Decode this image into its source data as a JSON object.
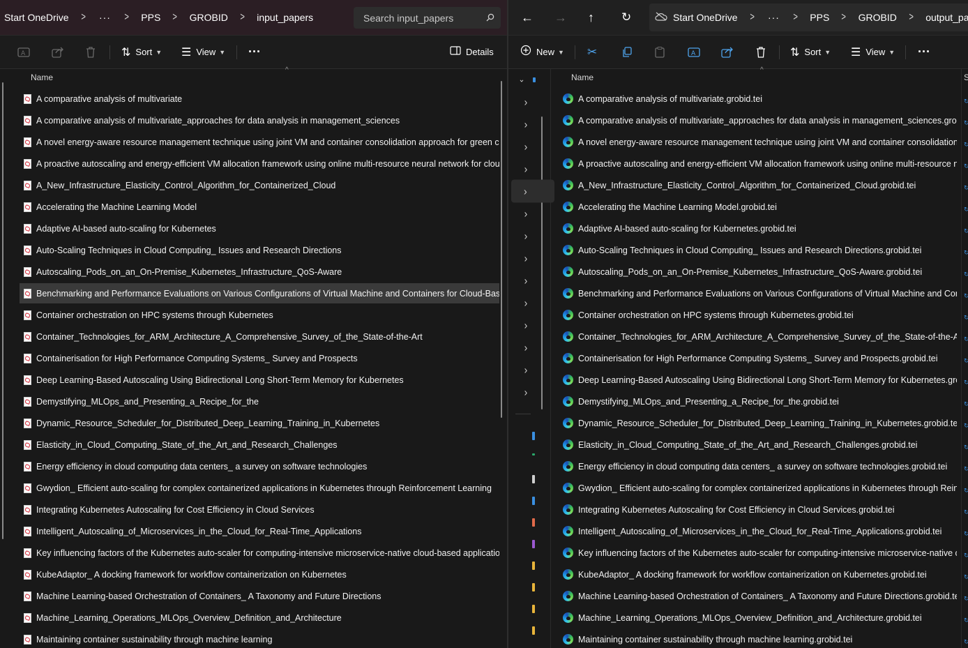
{
  "left": {
    "breadcrumbs": [
      "Start OneDrive",
      "PPS",
      "GROBID",
      "input_papers"
    ],
    "more": "···",
    "search_placeholder": "Search input_papers",
    "toolbar": {
      "sort": "Sort",
      "view": "View",
      "more": "···",
      "details": "Details"
    },
    "column_name": "Name",
    "selected_index": 9,
    "files": [
      "A comparative analysis of multivariate",
      "A comparative analysis of multivariate_approaches for data analysis in management_sciences",
      "A novel energy-aware resource management technique using joint VM and container consolidation approach for green comp",
      "A proactive autoscaling and energy-efficient VM allocation framework using online multi-resource neural network for cloud d",
      "A_New_Infrastructure_Elasticity_Control_Algorithm_for_Containerized_Cloud",
      "Accelerating the Machine Learning Model",
      "Adaptive AI-based auto-scaling for Kubernetes",
      "Auto-Scaling Techniques in Cloud Computing_ Issues and Research Directions",
      "Autoscaling_Pods_on_an_On-Premise_Kubernetes_Infrastructure_QoS-Aware",
      "Benchmarking and Performance Evaluations on Various Configurations of Virtual Machine and Containers for Cloud-Based Sc",
      "Container orchestration on HPC systems through Kubernetes",
      "Container_Technologies_for_ARM_Architecture_A_Comprehensive_Survey_of_the_State-of-the-Art",
      "Containerisation for High Performance Computing Systems_ Survey and Prospects",
      "Deep Learning-Based Autoscaling Using Bidirectional Long Short-Term Memory for Kubernetes",
      "Demystifying_MLOps_and_Presenting_a_Recipe_for_the",
      "Dynamic_Resource_Scheduler_for_Distributed_Deep_Learning_Training_in_Kubernetes",
      "Elasticity_in_Cloud_Computing_State_of_the_Art_and_Research_Challenges",
      "Energy efficiency in cloud computing data centers_ a survey on software technologies",
      "Gwydion_ Efficient auto-scaling for complex containerized applications in Kubernetes through Reinforcement Learning",
      "Integrating Kubernetes Autoscaling for Cost Efficiency in Cloud Services",
      "Intelligent_Autoscaling_of_Microservices_in_the_Cloud_for_Real-Time_Applications",
      "Key influencing factors of the Kubernetes auto-scaler for computing-intensive microservice-native cloud-based applications",
      "KubeAdaptor_ A docking framework for workflow containerization on Kubernetes",
      "Machine Learning-based Orchestration of Containers_ A Taxonomy and Future Directions",
      "Machine_Learning_Operations_MLOps_Overview_Definition_and_Architecture",
      "Maintaining container sustainability through machine learning"
    ]
  },
  "right": {
    "breadcrumbs": [
      "Start OneDrive",
      "PPS",
      "GROBID",
      "output_papers"
    ],
    "more": "···",
    "toolbar": {
      "new": "New",
      "sort": "Sort",
      "view": "View",
      "more": "···"
    },
    "column_name": "Name",
    "column_next": "S",
    "files": [
      "A comparative analysis of multivariate.grobid.tei",
      "A comparative analysis of multivariate_approaches for data analysis in management_sciences.grobid....",
      "A novel energy-aware resource management technique using joint VM and container consolidation a...",
      "A proactive autoscaling and energy-efficient VM allocation framework using online multi-resource n...",
      "A_New_Infrastructure_Elasticity_Control_Algorithm_for_Containerized_Cloud.grobid.tei",
      "Accelerating the Machine Learning Model.grobid.tei",
      "Adaptive AI-based auto-scaling for Kubernetes.grobid.tei",
      "Auto-Scaling Techniques in Cloud Computing_ Issues and Research Directions.grobid.tei",
      "Autoscaling_Pods_on_an_On-Premise_Kubernetes_Infrastructure_QoS-Aware.grobid.tei",
      "Benchmarking and Performance Evaluations on Various Configurations of Virtual Machine and Conta...",
      "Container orchestration on HPC systems through Kubernetes.grobid.tei",
      "Container_Technologies_for_ARM_Architecture_A_Comprehensive_Survey_of_the_State-of-the-Art.gr...",
      "Containerisation for High Performance Computing Systems_ Survey and Prospects.grobid.tei",
      "Deep Learning-Based Autoscaling Using Bidirectional Long Short-Term Memory for Kubernetes.grobi...",
      "Demystifying_MLOps_and_Presenting_a_Recipe_for_the.grobid.tei",
      "Dynamic_Resource_Scheduler_for_Distributed_Deep_Learning_Training_in_Kubernetes.grobid.tei",
      "Elasticity_in_Cloud_Computing_State_of_the_Art_and_Research_Challenges.grobid.tei",
      "Energy efficiency in cloud computing data centers_ a survey on software technologies.grobid.tei",
      "Gwydion_ Efficient auto-scaling for complex containerized applications in Kubernetes through Reinfo...",
      "Integrating Kubernetes Autoscaling for Cost Efficiency in Cloud Services.grobid.tei",
      "Intelligent_Autoscaling_of_Microservices_in_the_Cloud_for_Real-Time_Applications.grobid.tei",
      "Key influencing factors of the Kubernetes auto-scaler for computing-intensive microservice-native cl...",
      "KubeAdaptor_ A docking framework for workflow containerization on Kubernetes.grobid.tei",
      "Machine Learning-based Orchestration of Containers_ A Taxonomy and Future Directions.grobid.tei",
      "Machine_Learning_Operations_MLOps_Overview_Definition_and_Architecture.grobid.tei",
      "Maintaining container sustainability through machine learning.grobid.tei"
    ]
  },
  "colors": {
    "background": "#191919",
    "selection": "#3a3a3a",
    "pdf_red": "#d0202e",
    "accent_blue": "#3a8fe0"
  }
}
